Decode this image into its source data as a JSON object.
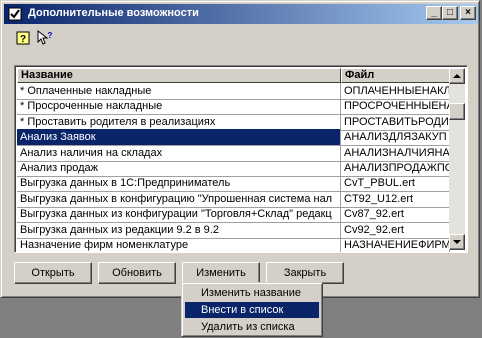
{
  "window": {
    "title": "Дополнительные возможности"
  },
  "caption_buttons": {
    "minimize": "_",
    "maximize": "□",
    "close": "×"
  },
  "toolbar": {
    "help_icon": "help-icon",
    "whats_this_icon": "whats-this-icon"
  },
  "grid": {
    "columns": [
      "Название",
      "Файл"
    ],
    "rows": [
      [
        "* Оплаченные накладные",
        "ОПЛАЧЕННЫЕНАКЛ"
      ],
      [
        "* Просроченные накладные",
        "ПРОСРОЧЕННЫЕНА"
      ],
      [
        "* Проставить родителя в реализациях",
        "ПРОСТАВИТЬРОДИТ"
      ],
      [
        "Анализ Заявок",
        "АНАЛИЗДЛЯЗАКУП"
      ],
      [
        "Анализ наличия на складах",
        "АНАЛИЗНАЛЧИЯНА"
      ],
      [
        "Анализ продаж",
        "АНАЛИЗПРОДАЖПО"
      ],
      [
        "Выгрузка данных в 1С:Предприниматель",
        "CvT_PBUL.ert"
      ],
      [
        "Выгрузка данных в конфигурацию \"Упрошенная система нал",
        "CT92_U12.ert"
      ],
      [
        "Выгрузка данных из конфигурации \"Торговля+Склад\" редакц",
        "Cv87_92.ert"
      ],
      [
        "Выгрузка данных из редакции 9.2 в 9.2",
        "Cv92_92.ert"
      ],
      [
        "Назначение фирм номенклатуре",
        "НАЗНАЧЕНИЕФИРМ"
      ]
    ],
    "selected_row": 3
  },
  "buttons": {
    "open": "Открыть",
    "refresh": "Обновить",
    "change": "Изменить",
    "close": "Закрыть"
  },
  "context_menu": {
    "items": [
      "Изменить название",
      "Внести в список",
      "Удалить из списка"
    ],
    "highlighted": 1
  },
  "colors": {
    "selection": "#0a246a",
    "face": "#d4d0c8"
  }
}
